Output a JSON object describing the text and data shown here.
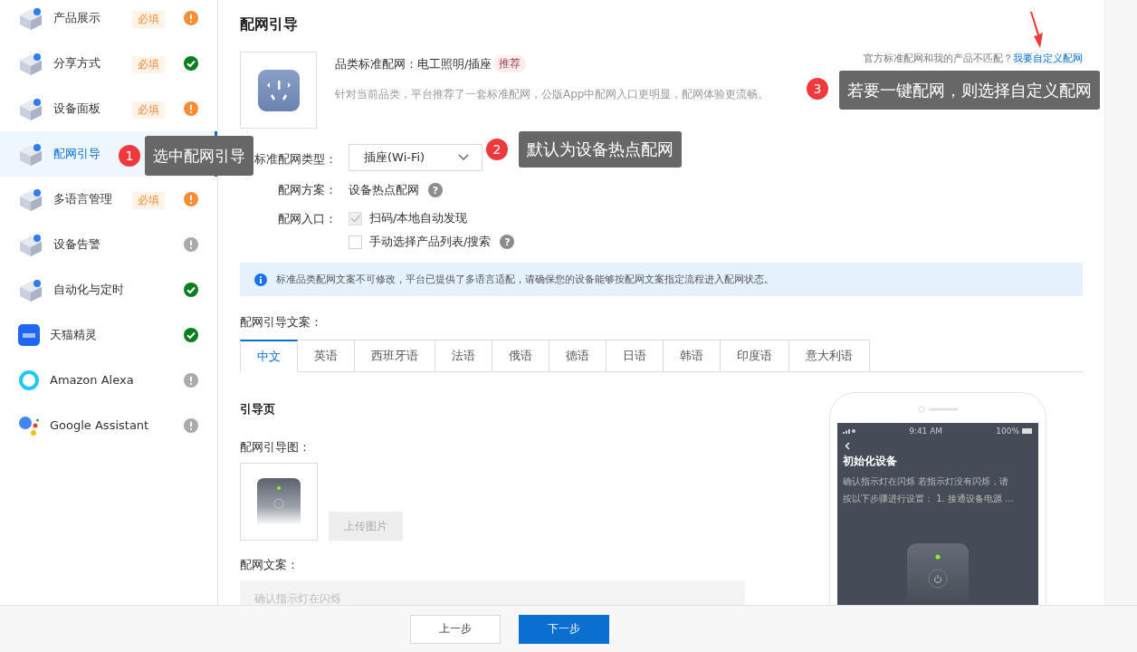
{
  "sidebar": {
    "items": [
      {
        "label": "产品展示",
        "tag": "必填",
        "complete": false,
        "color": "#fa8c35",
        "selected": false
      },
      {
        "label": "分享方式",
        "tag": "必填",
        "complete": true,
        "color": "#0a7d1e",
        "selected": false
      },
      {
        "label": "设备面板",
        "tag": "必填",
        "complete": false,
        "color": "#fa8c35",
        "selected": false
      },
      {
        "label": "配网引导",
        "selected": true
      },
      {
        "label": "多语言管理",
        "tag": "必填",
        "complete": false,
        "color": "#fa8c35",
        "selected": false
      },
      {
        "label": "设备告警",
        "complete": false,
        "color": "#aaaaaa",
        "selected": false
      },
      {
        "label": "自动化与定时",
        "complete": true,
        "color": "#0a7d1e",
        "selected": false
      },
      {
        "label": "天猫精灵",
        "complete": true,
        "color": "#0a7d1e",
        "selected": false
      },
      {
        "label": "Amazon Alexa",
        "complete": false,
        "color": "#aaaaaa",
        "selected": false
      },
      {
        "label": "Google Assistant",
        "complete": false,
        "color": "#aaaaaa",
        "selected": false
      }
    ]
  },
  "page": {
    "title": "配网引导"
  },
  "category": {
    "label": "品类标准配网：电工照明/插座",
    "tag": "推荐",
    "description": "针对当前品类，平台推荐了一套标准配网，公版App中配网入口更明显，配网体验更流畅。"
  },
  "custom_link": {
    "prompt": "官方标准配网和我的产品不匹配？",
    "link": "我要自定义配网"
  },
  "form": {
    "type": {
      "label": "标准配网类型：",
      "value": "插座(Wi-Fi)"
    },
    "scheme": {
      "label": "配网方案：",
      "value": "设备热点配网",
      "help": "?"
    },
    "entry": {
      "label": "配网入口：",
      "options": [
        {
          "label": "扫码/本地自动发现",
          "checked": true,
          "disabled": true
        },
        {
          "label": "手动选择产品列表/搜索",
          "checked": false,
          "disabled": false,
          "help": "?"
        }
      ]
    }
  },
  "notice": "标准品类配网文案不可修改，平台已提供了多语言适配，请确保您的设备能够按配网文案指定流程进入配网状态。",
  "copy_section": {
    "label": "配网引导文案：",
    "tabs": [
      {
        "label": "中文",
        "selected": true
      },
      {
        "label": "英语",
        "selected": false
      },
      {
        "label": "西班牙语",
        "selected": false
      },
      {
        "label": "法语",
        "selected": false
      },
      {
        "label": "俄语",
        "selected": false
      },
      {
        "label": "德语",
        "selected": false
      },
      {
        "label": "日语",
        "selected": false
      },
      {
        "label": "韩语",
        "selected": false
      },
      {
        "label": "印度语",
        "selected": false
      },
      {
        "label": "意大利语",
        "selected": false
      }
    ]
  },
  "guide_page": {
    "title": "引导页",
    "image_label": "配网引导图：",
    "upload_button": "上传图片",
    "copy_label": "配网文案：",
    "copy_text": "确认指示灯在闪烁"
  },
  "phone_preview": {
    "time": "9:41 AM",
    "battery": "100%",
    "title": "初始化设备",
    "lines": [
      "确认指示灯在闪烁 若指示灯没有闪烁，请",
      "按以下步骤进行设置： 1. 接通设备电源 ..."
    ]
  },
  "footer": {
    "buttons": [
      {
        "label": "上一步",
        "kind": "secondary"
      },
      {
        "label": "下一步",
        "kind": "primary"
      }
    ]
  },
  "annotations": [
    {
      "number": "1",
      "text": "选中配网引导"
    },
    {
      "number": "2",
      "text": "默认为设备热点配网"
    },
    {
      "number": "3",
      "text": "若要一键配网，则选择自定义配网"
    }
  ]
}
